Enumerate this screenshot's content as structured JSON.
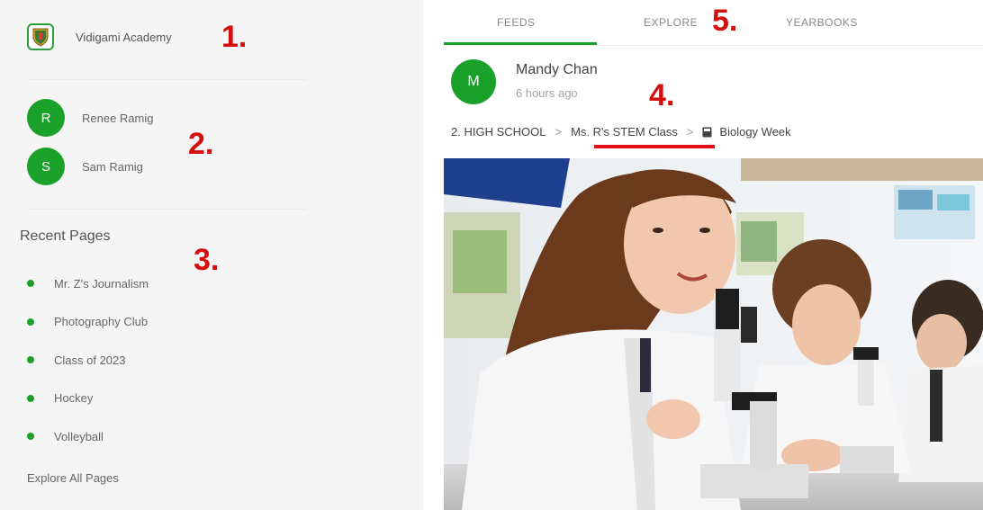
{
  "sidebar": {
    "school": {
      "name": "Vidigami Academy",
      "icon": "school-crest-icon"
    },
    "users": [
      {
        "initial": "R",
        "name": "Renee Ramig"
      },
      {
        "initial": "S",
        "name": "Sam Ramig"
      }
    ],
    "recent_title": "Recent Pages",
    "recent_pages": [
      {
        "label": "Mr. Z's Journalism"
      },
      {
        "label": "Photography Club"
      },
      {
        "label": "Class of 2023"
      },
      {
        "label": "Hockey"
      },
      {
        "label": "Volleyball"
      }
    ],
    "explore_all": "Explore All Pages"
  },
  "tabs": [
    {
      "label": "FEEDS",
      "active": true
    },
    {
      "label": "EXPLORE",
      "active": false
    },
    {
      "label": "YEARBOOKS",
      "active": false
    }
  ],
  "post": {
    "avatar_initial": "M",
    "author": "Mandy Chan",
    "time": "6 hours ago",
    "breadcrumb": {
      "level1": "2. HIGH SCHOOL",
      "separator": ">",
      "level2": "Ms. R's STEM Class",
      "level3": "Biology Week",
      "level3_icon": "album-icon"
    },
    "photo": "Students in a lab using microscopes"
  },
  "annotations": [
    "1.",
    "2.",
    "3.",
    "4.",
    "5."
  ],
  "colors": {
    "accent_green": "#1aa12a",
    "annotation_red": "#d40d0d",
    "sidebar_bg": "#f5f5f5"
  }
}
